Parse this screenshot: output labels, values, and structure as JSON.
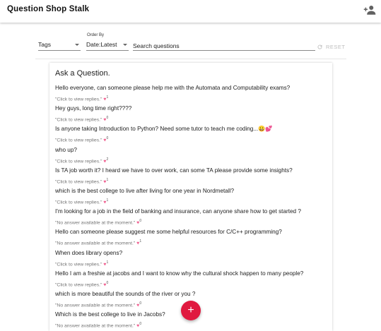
{
  "app": {
    "title": "Question Shop Stalk"
  },
  "filters": {
    "tags_label": "Tags",
    "order_by_label": "Order By",
    "order_by_value": "Date:Latest",
    "search_placeholder": "Search questions",
    "reset_label": "RESET"
  },
  "card": {
    "title": "Ask a Question."
  },
  "questions": [
    {
      "text": "Hello everyone, can someone please help me with the Automata and Computability exams?",
      "status": "\"Click to view replies.\"",
      "likes": "1"
    },
    {
      "text": "Hey guys, long time right????",
      "status": "\"Click to view replies.\"",
      "likes": "0"
    },
    {
      "text": "Is anyone taking Introduction to Python? Need some tutor to teach me coding...😀💕",
      "status": "\"Click to view replies.\"",
      "likes": "0"
    },
    {
      "text": "who up?",
      "status": "\"Click to view replies.\"",
      "likes": "2"
    },
    {
      "text": "Is TA job worth it? I heard we have to over work, can some TA please provide some insights?",
      "status": "\"Click to view replies.\"",
      "likes": "1"
    },
    {
      "text": "which is the best college to live after living for one year in Nordmetall?",
      "status": "\"Click to view replies.\"",
      "likes": "1"
    },
    {
      "text": "I'm looking for a job in the field of banking and insurance, can anyone share how to get started ?",
      "status": "\"No answer available at the moment.\"",
      "likes": "0"
    },
    {
      "text": "Hello can someone please suggest me some helpful resources for C/C++ programming?",
      "status": "\"No answer available at the moment.\"",
      "likes": "1"
    },
    {
      "text": "When does library opens?",
      "status": "\"Click to view replies.\"",
      "likes": "1"
    },
    {
      "text": "Hello I am a freshie at jacobs and I want to know why the cultural shock happen to many people?",
      "status": "\"Click to view replies.\"",
      "likes": "0"
    },
    {
      "text": "which is more beautiful the sounds of the river or you ?",
      "status": "\"No answer available at the moment.\"",
      "likes": "0"
    },
    {
      "text": "Which is the best college to live in Jacobs?",
      "status": "\"No answer available at the moment.\"",
      "likes": "0"
    }
  ],
  "icons": {
    "add_person": "person-add-icon",
    "reset": "refresh-icon",
    "heart": "heart-icon",
    "fab": "plus-icon"
  },
  "colors": {
    "fab": "#e0193f",
    "heart": "#f06292"
  }
}
